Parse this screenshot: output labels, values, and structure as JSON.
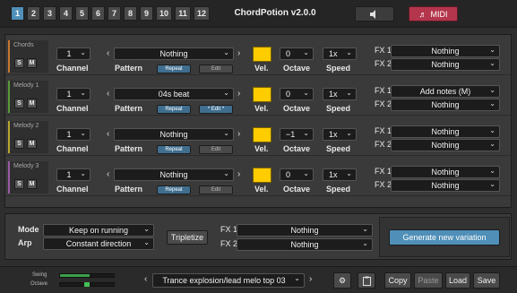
{
  "header": {
    "tabs": [
      "1",
      "2",
      "3",
      "4",
      "5",
      "6",
      "7",
      "8",
      "9",
      "10",
      "11",
      "12"
    ],
    "active_tab": "1",
    "title": "ChordPotion v2.0.0",
    "speaker_icon": "speaker-icon",
    "midi_label": "MIDI",
    "midi_icon": "music-note-icon",
    "midi_color": "#b4364c",
    "accent": "#4f8fb8"
  },
  "rows": [
    {
      "label": "Chords",
      "color": "#c77830",
      "solo": "S",
      "mute": "M",
      "channel": "1",
      "channel_lbl": "Channel",
      "pattern": "Nothing",
      "pattern_lbl": "Pattern",
      "repeat": "Repeat",
      "edit": "Edit",
      "vel_lbl": "Vel.",
      "octave": "0",
      "octave_lbl": "Octave",
      "speed": "1x",
      "speed_lbl": "Speed",
      "fx1_lbl": "FX 1",
      "fx1": "Nothing",
      "fx2_lbl": "FX 2",
      "fx2": "Nothing"
    },
    {
      "label": "Melody 1",
      "color": "#5a9a3a",
      "solo": "S",
      "mute": "M",
      "channel": "1",
      "channel_lbl": "Channel",
      "pattern": "04s beat",
      "pattern_lbl": "Pattern",
      "repeat": "Repeat",
      "edit": "* Edit *",
      "vel_lbl": "Vel.",
      "octave": "0",
      "octave_lbl": "Octave",
      "speed": "1x",
      "speed_lbl": "Speed",
      "fx1_lbl": "FX 1",
      "fx1": "Add notes (M)",
      "fx2_lbl": "FX 2",
      "fx2": "Nothing"
    },
    {
      "label": "Melody 2",
      "color": "#b8a830",
      "solo": "S",
      "mute": "M",
      "channel": "1",
      "channel_lbl": "Channel",
      "pattern": "Nothing",
      "pattern_lbl": "Pattern",
      "repeat": "Repeat",
      "edit": "Edit",
      "vel_lbl": "Vel.",
      "octave": "−1",
      "octave_lbl": "Octave",
      "speed": "1x",
      "speed_lbl": "Speed",
      "fx1_lbl": "FX 1",
      "fx1": "Nothing",
      "fx2_lbl": "FX 2",
      "fx2": "Nothing"
    },
    {
      "label": "Melody 3",
      "color": "#9a5aa8",
      "solo": "S",
      "mute": "M",
      "channel": "1",
      "channel_lbl": "Channel",
      "pattern": "Nothing",
      "pattern_lbl": "Pattern",
      "repeat": "Repeat",
      "edit": "Edit",
      "vel_lbl": "Vel.",
      "octave": "0",
      "octave_lbl": "Octave",
      "speed": "1x",
      "speed_lbl": "Speed",
      "fx1_lbl": "FX 1",
      "fx1": "Nothing",
      "fx2_lbl": "FX 2",
      "fx2": "Nothing"
    }
  ],
  "global": {
    "mode_lbl": "Mode",
    "mode": "Keep on running",
    "arp_lbl": "Arp",
    "arp": "Constant direction",
    "tripletize": "Tripletize",
    "fx1_lbl": "FX 1",
    "fx1": "Nothing",
    "fx2_lbl": "FX 2",
    "fx2": "Nothing",
    "generate": "Generate new variation"
  },
  "footer": {
    "swing_lbl": "Swing",
    "octave_lbl": "Octave",
    "swing_level": 0.55,
    "octave_level": 0.5,
    "preset": "Trance explosion/lead melo top 03",
    "settings_icon": "gear-icon",
    "clipboard_icon": "clipboard-icon",
    "copy": "Copy",
    "paste": "Paste",
    "load": "Load",
    "save": "Save"
  }
}
